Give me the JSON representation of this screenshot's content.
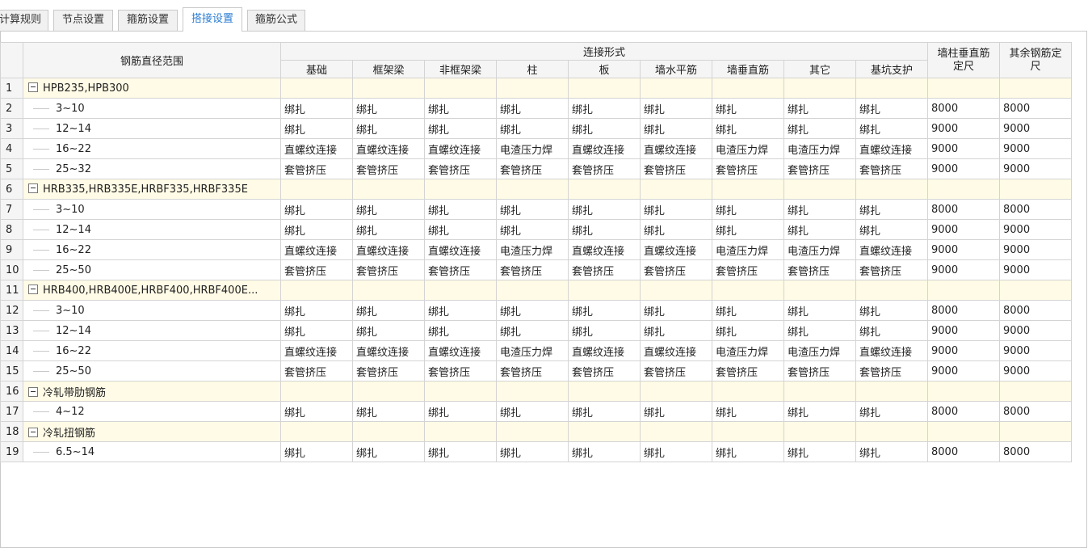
{
  "tabs": [
    {
      "label": "计算规则",
      "active": false
    },
    {
      "label": "节点设置",
      "active": false
    },
    {
      "label": "箍筋设置",
      "active": false
    },
    {
      "label": "搭接设置",
      "active": true
    },
    {
      "label": "箍筋公式",
      "active": false
    }
  ],
  "table": {
    "header": {
      "range": "钢筋直径范围",
      "group": "连接形式",
      "columns": [
        "基础",
        "框架梁",
        "非框架梁",
        "柱",
        "板",
        "墙水平筋",
        "墙垂直筋",
        "其它",
        "基坑支护"
      ],
      "col_wall_v_line1": "墙柱垂直筋",
      "col_wall_v_line2": "定尺",
      "col_other_line1": "其余钢筋定",
      "col_other_line2": "尺"
    },
    "rows": [
      {
        "num": "1",
        "group": true,
        "label": "HPB235,HPB300"
      },
      {
        "num": "2",
        "range": "3~10",
        "cells": [
          "绑扎",
          "绑扎",
          "绑扎",
          "绑扎",
          "绑扎",
          "绑扎",
          "绑扎",
          "绑扎",
          "绑扎"
        ],
        "v": "8000",
        "o": "8000"
      },
      {
        "num": "3",
        "range": "12~14",
        "cells": [
          "绑扎",
          "绑扎",
          "绑扎",
          "绑扎",
          "绑扎",
          "绑扎",
          "绑扎",
          "绑扎",
          "绑扎"
        ],
        "v": "9000",
        "o": "9000"
      },
      {
        "num": "4",
        "range": "16~22",
        "cells": [
          "直螺纹连接",
          "直螺纹连接",
          "直螺纹连接",
          "电渣压力焊",
          "直螺纹连接",
          "直螺纹连接",
          "电渣压力焊",
          "电渣压力焊",
          "直螺纹连接"
        ],
        "v": "9000",
        "o": "9000"
      },
      {
        "num": "5",
        "range": "25~32",
        "cells": [
          "套管挤压",
          "套管挤压",
          "套管挤压",
          "套管挤压",
          "套管挤压",
          "套管挤压",
          "套管挤压",
          "套管挤压",
          "套管挤压"
        ],
        "v": "9000",
        "o": "9000"
      },
      {
        "num": "6",
        "group": true,
        "label": "HRB335,HRB335E,HRBF335,HRBF335E"
      },
      {
        "num": "7",
        "range": "3~10",
        "cells": [
          "绑扎",
          "绑扎",
          "绑扎",
          "绑扎",
          "绑扎",
          "绑扎",
          "绑扎",
          "绑扎",
          "绑扎"
        ],
        "v": "8000",
        "o": "8000"
      },
      {
        "num": "8",
        "range": "12~14",
        "cells": [
          "绑扎",
          "绑扎",
          "绑扎",
          "绑扎",
          "绑扎",
          "绑扎",
          "绑扎",
          "绑扎",
          "绑扎"
        ],
        "v": "9000",
        "o": "9000"
      },
      {
        "num": "9",
        "range": "16~22",
        "cells": [
          "直螺纹连接",
          "直螺纹连接",
          "直螺纹连接",
          "电渣压力焊",
          "直螺纹连接",
          "直螺纹连接",
          "电渣压力焊",
          "电渣压力焊",
          "直螺纹连接"
        ],
        "v": "9000",
        "o": "9000"
      },
      {
        "num": "10",
        "range": "25~50",
        "cells": [
          "套管挤压",
          "套管挤压",
          "套管挤压",
          "套管挤压",
          "套管挤压",
          "套管挤压",
          "套管挤压",
          "套管挤压",
          "套管挤压"
        ],
        "v": "9000",
        "o": "9000"
      },
      {
        "num": "11",
        "group": true,
        "label": "HRB400,HRB400E,HRBF400,HRBF400E..."
      },
      {
        "num": "12",
        "range": "3~10",
        "cells": [
          "绑扎",
          "绑扎",
          "绑扎",
          "绑扎",
          "绑扎",
          "绑扎",
          "绑扎",
          "绑扎",
          "绑扎"
        ],
        "v": "8000",
        "o": "8000"
      },
      {
        "num": "13",
        "range": "12~14",
        "cells": [
          "绑扎",
          "绑扎",
          "绑扎",
          "绑扎",
          "绑扎",
          "绑扎",
          "绑扎",
          "绑扎",
          "绑扎"
        ],
        "v": "9000",
        "o": "9000"
      },
      {
        "num": "14",
        "range": "16~22",
        "cells": [
          "直螺纹连接",
          "直螺纹连接",
          "直螺纹连接",
          "电渣压力焊",
          "直螺纹连接",
          "直螺纹连接",
          "电渣压力焊",
          "电渣压力焊",
          "直螺纹连接"
        ],
        "v": "9000",
        "o": "9000"
      },
      {
        "num": "15",
        "range": "25~50",
        "cells": [
          "套管挤压",
          "套管挤压",
          "套管挤压",
          "套管挤压",
          "套管挤压",
          "套管挤压",
          "套管挤压",
          "套管挤压",
          "套管挤压"
        ],
        "v": "9000",
        "o": "9000"
      },
      {
        "num": "16",
        "group": true,
        "label": "冷轧带肋钢筋"
      },
      {
        "num": "17",
        "range": "4~12",
        "cells": [
          "绑扎",
          "绑扎",
          "绑扎",
          "绑扎",
          "绑扎",
          "绑扎",
          "绑扎",
          "绑扎",
          "绑扎"
        ],
        "v": "8000",
        "o": "8000"
      },
      {
        "num": "18",
        "group": true,
        "label": "冷轧扭钢筋"
      },
      {
        "num": "19",
        "range": "6.5~14",
        "cells": [
          "绑扎",
          "绑扎",
          "绑扎",
          "绑扎",
          "绑扎",
          "绑扎",
          "绑扎",
          "绑扎",
          "绑扎"
        ],
        "v": "8000",
        "o": "8000"
      }
    ]
  }
}
